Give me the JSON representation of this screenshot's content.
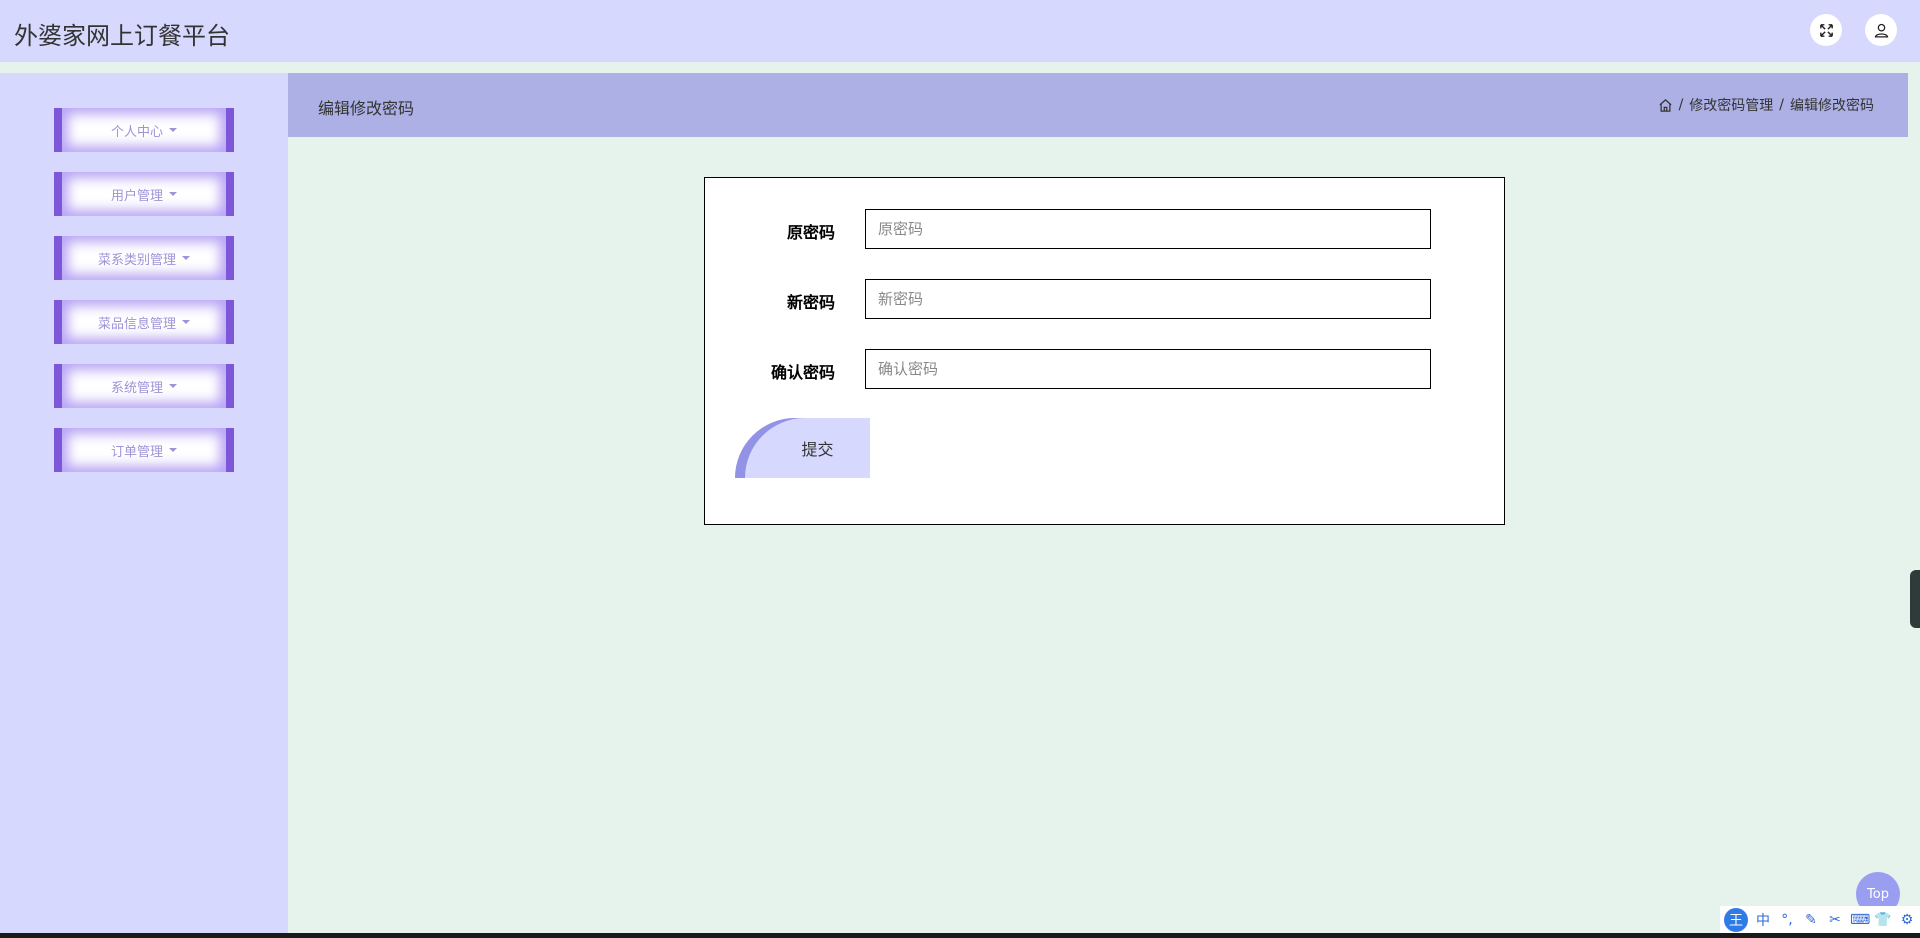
{
  "app": {
    "title": "外婆家网上订餐平台"
  },
  "header": {
    "fullscreen_icon": "expand-icon",
    "user_icon": "user-icon"
  },
  "sidebar": {
    "items": [
      {
        "label": "个人中心"
      },
      {
        "label": "用户管理"
      },
      {
        "label": "菜系类别管理"
      },
      {
        "label": "菜品信息管理"
      },
      {
        "label": "系统管理"
      },
      {
        "label": "订单管理"
      }
    ]
  },
  "page": {
    "title": "编辑修改密码",
    "breadcrumb": [
      "修改密码管理",
      "编辑修改密码"
    ],
    "breadcrumb_separator": "/"
  },
  "form": {
    "fields": [
      {
        "label": "原密码",
        "placeholder": "原密码",
        "value": ""
      },
      {
        "label": "新密码",
        "placeholder": "新密码",
        "value": ""
      },
      {
        "label": "确认密码",
        "placeholder": "确认密码",
        "value": ""
      }
    ],
    "submit_label": "提交"
  },
  "floating": {
    "top_label": "Top"
  },
  "ime": {
    "logo": "王",
    "items": [
      "中",
      "°,",
      "✎",
      "✂",
      "⌨",
      "👕",
      "⚙"
    ]
  },
  "colors": {
    "header_bg": "#d6d8fd",
    "content_bg": "#e6f2ec",
    "crumb_bg": "#acb0e5",
    "menu_border": "#7e56d8",
    "menu_text": "#9d93d8"
  }
}
